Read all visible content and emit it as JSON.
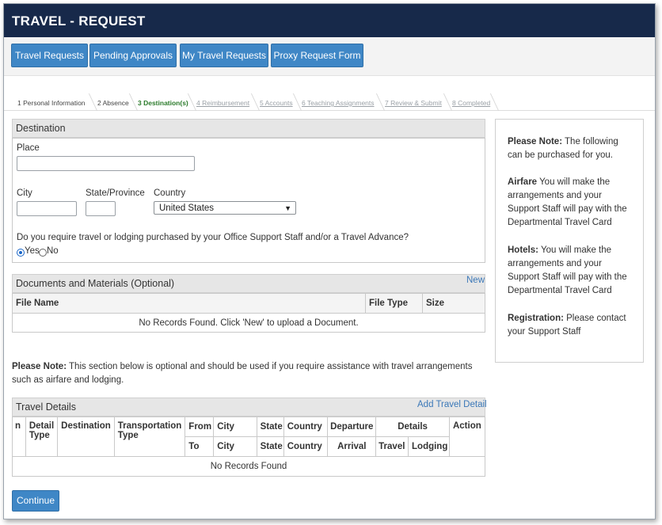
{
  "header": {
    "title": "TRAVEL - REQUEST"
  },
  "nav": {
    "buttons": [
      "Travel Requests",
      "Pending Approvals",
      "My Travel Requests",
      "Proxy Request Form"
    ]
  },
  "steps": [
    {
      "label": "1 Personal Information",
      "state": "done"
    },
    {
      "label": "2 Absence",
      "state": "done"
    },
    {
      "label": "3 Destination(s)",
      "state": "active"
    },
    {
      "label": "4 Reimbursement",
      "state": "disabled"
    },
    {
      "label": "5 Accounts",
      "state": "disabled"
    },
    {
      "label": "6 Teaching Assignments",
      "state": "disabled"
    },
    {
      "label": "7 Review & Submit",
      "state": "disabled"
    },
    {
      "label": "8 Completed",
      "state": "disabled"
    }
  ],
  "destination": {
    "heading": "Destination",
    "place_label": "Place",
    "place_value": "",
    "city_label": "City",
    "city_value": "",
    "state_label": "State/Province",
    "state_value": "",
    "country_label": "Country",
    "country_value": "United States",
    "question": "Do you require travel or lodging purchased by your Office Support Staff and/or a Travel Advance?",
    "yes_label": "Yes",
    "no_label": "No",
    "selected": "Yes"
  },
  "documents": {
    "heading": "Documents and Materials (Optional)",
    "new_link": "New",
    "columns": [
      "File Name",
      "File Type",
      "Size"
    ],
    "empty_text": "No Records Found. Click 'New' to upload a Document."
  },
  "optional_note": {
    "bold": "Please Note:",
    "text": " This section below is optional and should be used if you require assistance with travel arrangements such as airfare and lodging."
  },
  "travel_details": {
    "heading": "Travel Details",
    "add_link": "Add Travel Detail",
    "header_row1": {
      "n": "n",
      "detail_type": "Detail Type",
      "destination": "Destination",
      "transportation_type": "Transportation Type",
      "from": "From",
      "city": "City",
      "state": "State",
      "country": "Country",
      "departure": "Departure",
      "details": "Details",
      "action": "Action"
    },
    "header_row2": {
      "to": "To",
      "city": "City",
      "state": "State",
      "country": "Country",
      "arrival": "Arrival",
      "travel": "Travel",
      "lodging": "Lodging"
    },
    "empty_text": "No Records Found"
  },
  "side_note": {
    "p1_bold": "Please Note:",
    "p1_text": " The following can be purchased for you.",
    "p2_bold": "Airfare",
    "p2_text": " You will make the arrangements and your Support Staff will pay with the Departmental Travel Card",
    "p3_bold": "Hotels:",
    "p3_text": " You will make the arrangements and your Support Staff will pay with the Departmental Travel Card",
    "p4_bold": "Registration:",
    "p4_text": " Please contact your Support Staff"
  },
  "continue_button": "Continue",
  "colors": {
    "header_bg": "#17294a",
    "button": "#3f87c6",
    "active_step": "#2a7a2a",
    "link": "#3b78b8"
  }
}
